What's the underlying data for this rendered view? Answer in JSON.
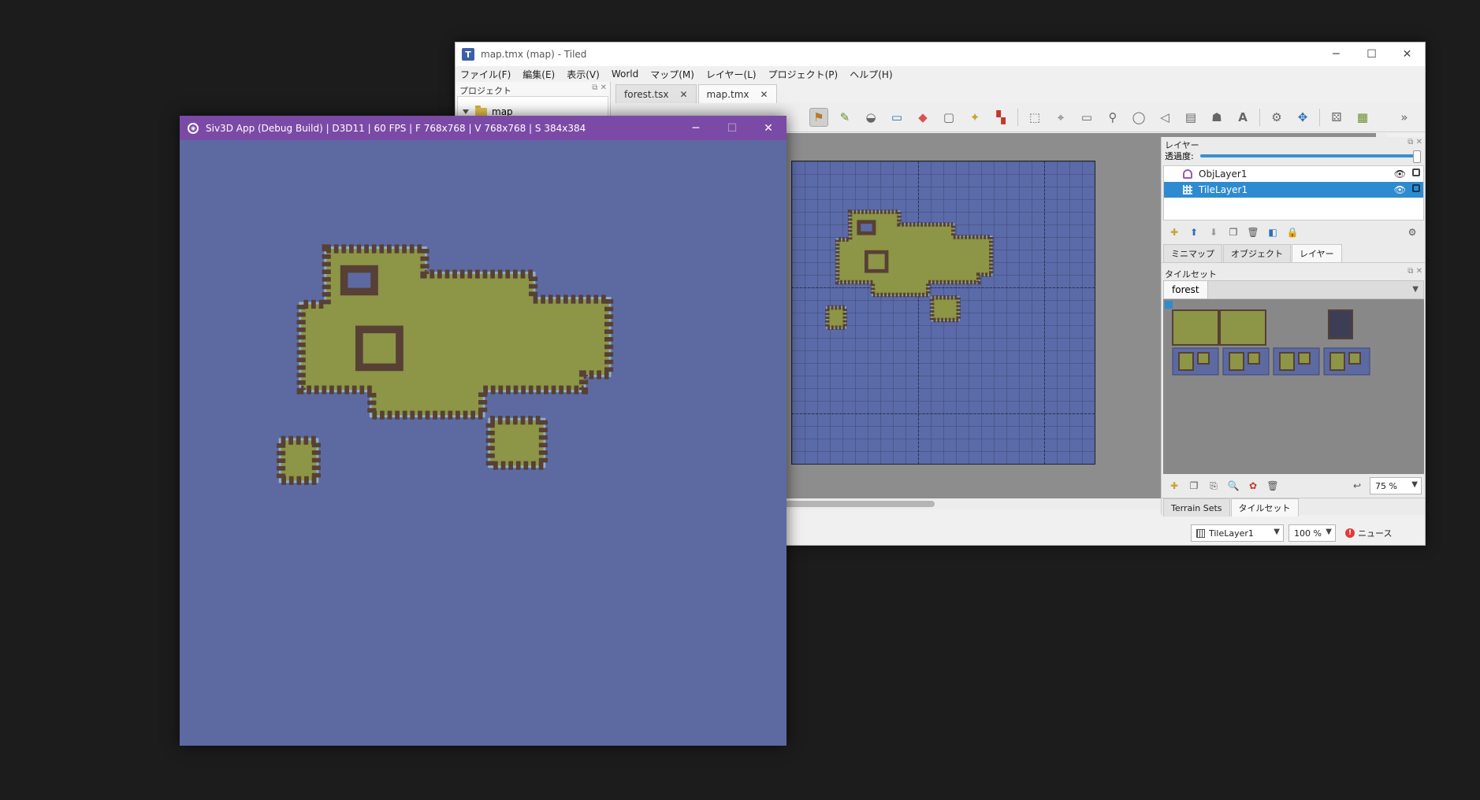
{
  "tiled": {
    "title": "map.tmx (map) - Tiled",
    "menu": [
      "ファイル(F)",
      "編集(E)",
      "表示(V)",
      "World",
      "マップ(M)",
      "レイヤー(L)",
      "プロジェクト(P)",
      "ヘルプ(H)"
    ],
    "project_panel": {
      "title": "プロジェクト",
      "folder": "map"
    },
    "doc_tabs": [
      {
        "label": "forest.tsx",
        "active": false
      },
      {
        "label": "map.tmx",
        "active": true
      }
    ],
    "close_glyph": "✕",
    "layers_panel": {
      "title": "レイヤー",
      "opacity_label": "透過度:",
      "layers": [
        {
          "name": "ObjLayer1",
          "type": "object",
          "selected": false
        },
        {
          "name": "TileLayer1",
          "type": "tile",
          "selected": true
        }
      ]
    },
    "dock_tabs": [
      "ミニマップ",
      "オブジェクト",
      "レイヤー"
    ],
    "tileset_panel": {
      "title": "タイルセット",
      "tileset_name": "forest",
      "zoom": "75 %"
    },
    "bottom_tabs": [
      "Terrain Sets",
      "タイルセット"
    ],
    "status": {
      "layer": "TileLayer1",
      "zoom": "100 %",
      "news": "ニュース"
    },
    "colors": {
      "water": "#5d6aa2",
      "grass": "#8d9546",
      "border": "#574035",
      "highlight": "#c7a94a",
      "selection": "#2f8bd0",
      "siv_titlebar": "#7b4aa6"
    }
  },
  "siv": {
    "title": "Siv3D App (Debug Build) | D3D11 | 60 FPS | F 768x768 | V 768x768 | S 384x384"
  }
}
